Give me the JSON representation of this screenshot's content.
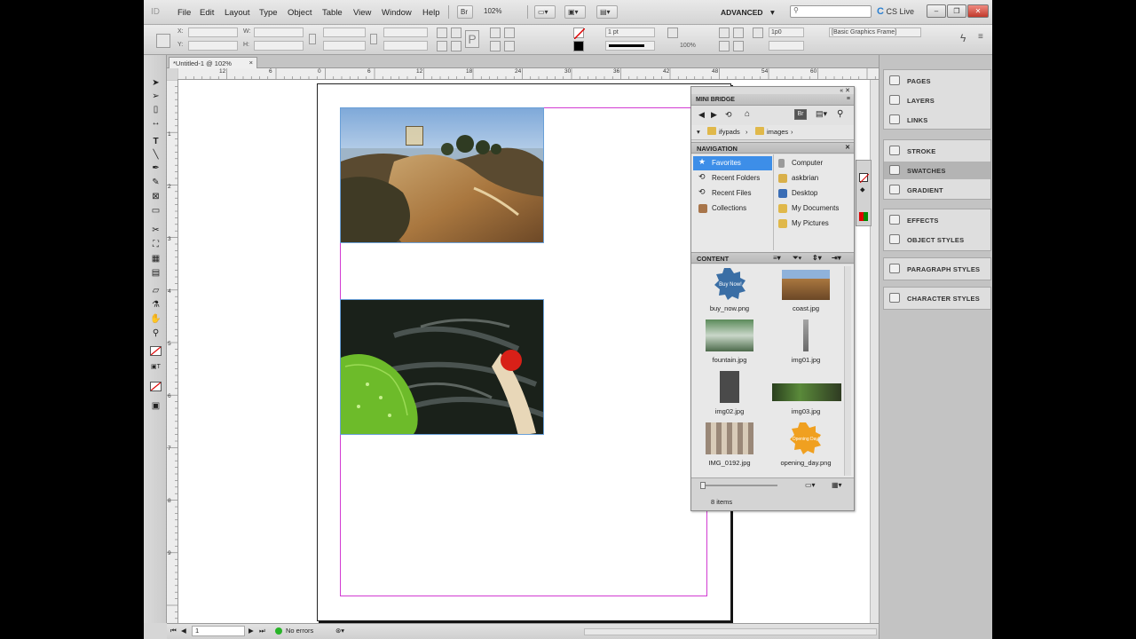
{
  "menubar": {
    "logo": "ID",
    "items": [
      "File",
      "Edit",
      "Layout",
      "Type",
      "Object",
      "Table",
      "View",
      "Window",
      "Help"
    ],
    "bridge_button": "Br",
    "zoom": "102%",
    "workspace": "ADVANCED",
    "cs_live": "CS Live"
  },
  "control": {
    "x_label": "X:",
    "y_label": "Y:",
    "w_label": "W:",
    "h_label": "H:",
    "stroke_weight": "1 pt",
    "opacity": "100%",
    "offset": "1p0",
    "object_style": "[Basic Graphics Frame]"
  },
  "document": {
    "tab_title": "*Untitled-1 @ 102%",
    "tab_close": "×"
  },
  "ruler": {
    "h_numbers": [
      "12",
      "6",
      "0",
      "6",
      "12",
      "18",
      "24",
      "30",
      "36",
      "42",
      "48",
      "54",
      "60"
    ],
    "v_numbers": [
      "1",
      "2",
      "3",
      "4",
      "5",
      "6",
      "7",
      "8",
      "9"
    ]
  },
  "status": {
    "page": "1",
    "preflight": "No errors"
  },
  "right_panels": {
    "group1": [
      "PAGES",
      "LAYERS",
      "LINKS"
    ],
    "group2": [
      "STROKE",
      "SWATCHES",
      "GRADIENT"
    ],
    "group3": [
      "EFFECTS",
      "OBJECT STYLES"
    ],
    "group4": [
      "PARAGRAPH STYLES"
    ],
    "group5": [
      "CHARACTER STYLES"
    ]
  },
  "mini_bridge": {
    "title": "MINI BRIDGE",
    "breadcrumb": [
      "ifypads",
      "images"
    ],
    "navigation_header": "NAVIGATION",
    "nav_left": [
      "Favorites",
      "Recent Folders",
      "Recent Files",
      "Collections"
    ],
    "nav_right": [
      "Computer",
      "askbrian",
      "Desktop",
      "My Documents",
      "My Pictures"
    ],
    "content_header": "CONTENT",
    "files": [
      {
        "name": "buy_now.png"
      },
      {
        "name": "coast.jpg"
      },
      {
        "name": "fountain.jpg"
      },
      {
        "name": "img01.jpg"
      },
      {
        "name": "img02.jpg"
      },
      {
        "name": "img03.jpg"
      },
      {
        "name": "IMG_0192.jpg"
      },
      {
        "name": "opening_day.png"
      }
    ],
    "badge_text": "Buy Now!",
    "badge2_text": "Opening Day!",
    "item_count": "8 items"
  },
  "colors": {
    "accent": "#3d8ee8",
    "margin_guide": "#d23bd2",
    "frame_edge": "#6aa0d8"
  }
}
